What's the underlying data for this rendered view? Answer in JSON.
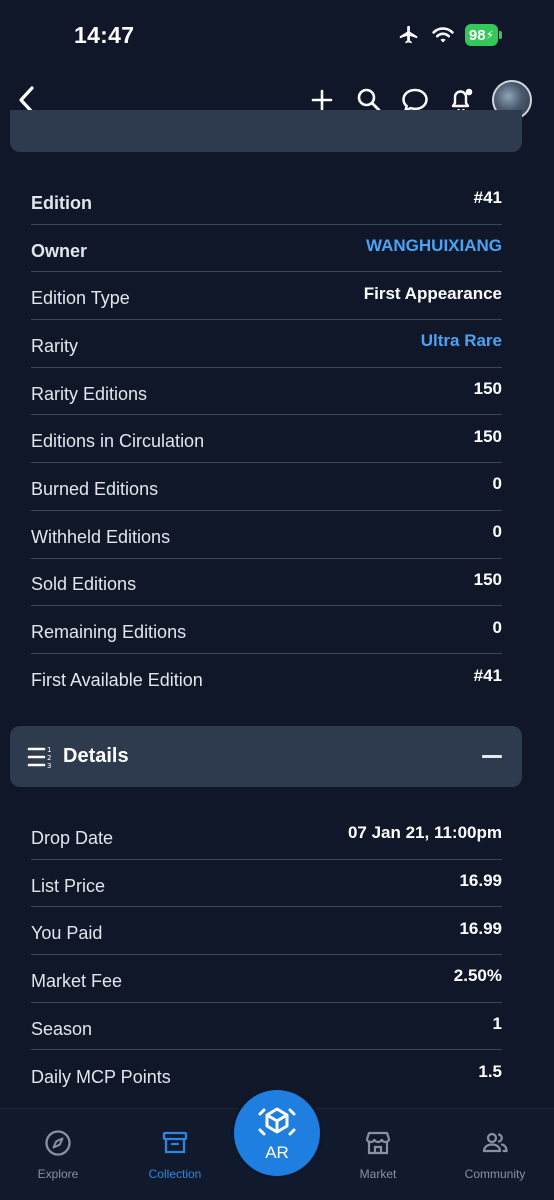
{
  "status_bar": {
    "time": "14:47",
    "battery": "98"
  },
  "nav": {
    "back_icon": "chevron-left-icon",
    "actions": [
      "plus-icon",
      "search-icon",
      "chat-icon",
      "bell-icon",
      "avatar"
    ]
  },
  "edition_rows": [
    {
      "label": "Edition",
      "value": "#41",
      "bold_label": true,
      "link": false
    },
    {
      "label": "Owner",
      "value": "WANGHUIXIANG",
      "bold_label": true,
      "link": true
    },
    {
      "label": "Edition Type",
      "value": "First Appearance",
      "bold_label": false,
      "link": false
    },
    {
      "label": "Rarity",
      "value": "Ultra Rare",
      "bold_label": false,
      "link": true
    },
    {
      "label": "Rarity Editions",
      "value": "150",
      "bold_label": false,
      "link": false
    },
    {
      "label": "Editions in Circulation",
      "value": "150",
      "bold_label": false,
      "link": false
    },
    {
      "label": "Burned Editions",
      "value": "0",
      "bold_label": false,
      "link": false
    },
    {
      "label": "Withheld Editions",
      "value": "0",
      "bold_label": false,
      "link": false
    },
    {
      "label": "Sold Editions",
      "value": "150",
      "bold_label": false,
      "link": false
    },
    {
      "label": "Remaining Editions",
      "value": "0",
      "bold_label": false,
      "link": false
    },
    {
      "label": "First Available Edition",
      "value": "#41",
      "bold_label": false,
      "link": false
    }
  ],
  "details": {
    "title": "Details",
    "icon": "numbered-list-icon",
    "rows": [
      {
        "label": "Drop Date",
        "value": "07 Jan 21, 11:00pm"
      },
      {
        "label": "List Price",
        "value": "16.99"
      },
      {
        "label": "You Paid",
        "value": "16.99"
      },
      {
        "label": "Market Fee",
        "value": "2.50%"
      },
      {
        "label": "Season",
        "value": "1"
      },
      {
        "label": "Daily MCP Points",
        "value": "1.5"
      }
    ]
  },
  "tabs": [
    {
      "label": "Explore",
      "icon": "compass-icon",
      "active": false
    },
    {
      "label": "Collection",
      "icon": "archive-box-icon",
      "active": true
    },
    {
      "label": "Market",
      "icon": "storefront-icon",
      "active": false
    },
    {
      "label": "Community",
      "icon": "people-icon",
      "active": false
    }
  ],
  "ar_button": {
    "label": "AR",
    "icon": "ar-cube-icon"
  },
  "colors": {
    "background": "#0f1729",
    "panel": "#2e3a4d",
    "link": "#4aa3f5",
    "accent": "#1f7fe0",
    "battery": "#34c759"
  }
}
